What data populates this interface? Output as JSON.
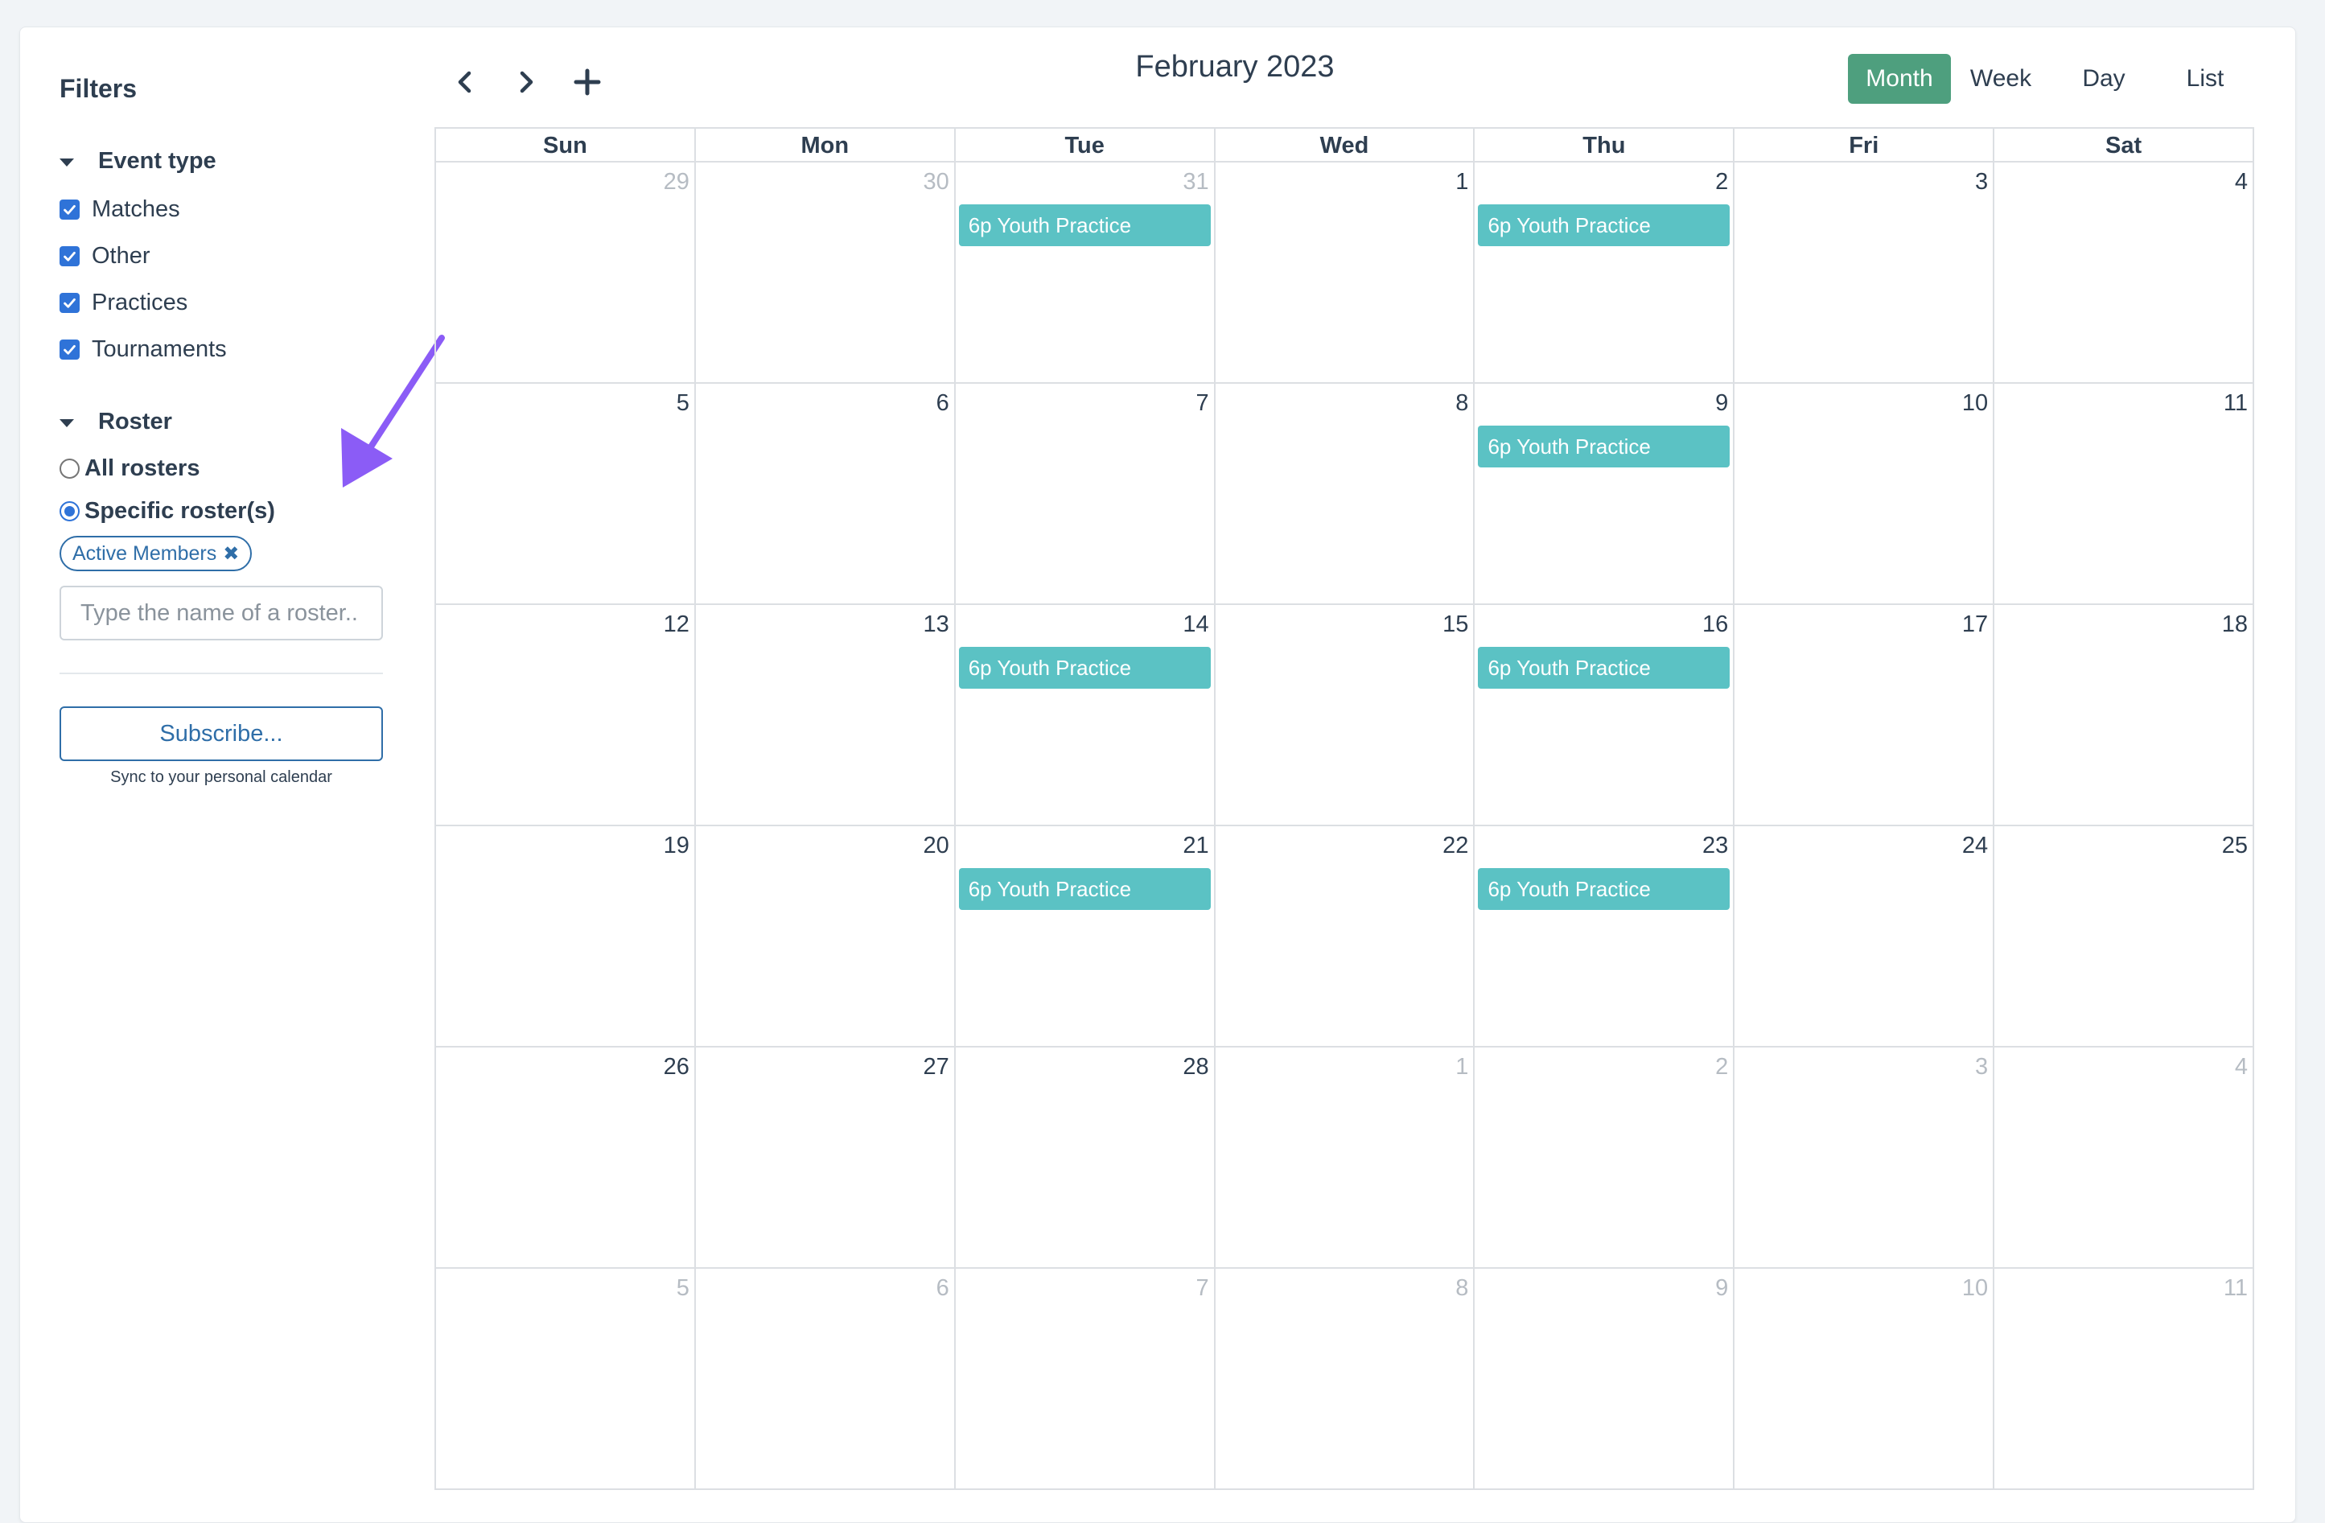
{
  "sidebar": {
    "filters_title": "Filters",
    "event_type": {
      "label": "Event type",
      "options": [
        {
          "label": "Matches",
          "checked": true
        },
        {
          "label": "Other",
          "checked": true
        },
        {
          "label": "Practices",
          "checked": true
        },
        {
          "label": "Tournaments",
          "checked": true
        }
      ]
    },
    "roster": {
      "label": "Roster",
      "all_label": "All rosters",
      "specific_label": "Specific roster(s)",
      "selected": "specific",
      "tag": "Active Members",
      "input_placeholder": "Type the name of a roster..",
      "input_value": ""
    },
    "subscribe_label": "Subscribe...",
    "sync_note": "Sync to your personal calendar"
  },
  "toolbar": {
    "title": "February 2023",
    "prev_icon": "chevron-left-icon",
    "next_icon": "chevron-right-icon",
    "add_icon": "plus-icon",
    "views": [
      "Month",
      "Week",
      "Day",
      "List"
    ],
    "active_view": "Month"
  },
  "calendar": {
    "weekdays": [
      "Sun",
      "Mon",
      "Tue",
      "Wed",
      "Thu",
      "Fri",
      "Sat"
    ],
    "weeks": [
      [
        {
          "n": "29",
          "o": true
        },
        {
          "n": "30",
          "o": true
        },
        {
          "n": "31",
          "o": true,
          "ev": "6p Youth Practice"
        },
        {
          "n": "1"
        },
        {
          "n": "2",
          "ev": "6p Youth Practice"
        },
        {
          "n": "3"
        },
        {
          "n": "4"
        }
      ],
      [
        {
          "n": "5"
        },
        {
          "n": "6"
        },
        {
          "n": "7"
        },
        {
          "n": "8"
        },
        {
          "n": "9",
          "ev": "6p Youth Practice"
        },
        {
          "n": "10"
        },
        {
          "n": "11"
        }
      ],
      [
        {
          "n": "12"
        },
        {
          "n": "13"
        },
        {
          "n": "14",
          "ev": "6p Youth Practice"
        },
        {
          "n": "15"
        },
        {
          "n": "16",
          "ev": "6p Youth Practice"
        },
        {
          "n": "17"
        },
        {
          "n": "18"
        }
      ],
      [
        {
          "n": "19"
        },
        {
          "n": "20"
        },
        {
          "n": "21",
          "ev": "6p Youth Practice"
        },
        {
          "n": "22"
        },
        {
          "n": "23",
          "ev": "6p Youth Practice"
        },
        {
          "n": "24"
        },
        {
          "n": "25"
        }
      ],
      [
        {
          "n": "26"
        },
        {
          "n": "27"
        },
        {
          "n": "28"
        },
        {
          "n": "1",
          "o": true
        },
        {
          "n": "2",
          "o": true
        },
        {
          "n": "3",
          "o": true
        },
        {
          "n": "4",
          "o": true
        }
      ],
      [
        {
          "n": "5",
          "o": true
        },
        {
          "n": "6",
          "o": true
        },
        {
          "n": "7",
          "o": true
        },
        {
          "n": "8",
          "o": true
        },
        {
          "n": "9",
          "o": true
        },
        {
          "n": "10",
          "o": true
        },
        {
          "n": "11",
          "o": true
        }
      ]
    ]
  },
  "colors": {
    "accent_blue": "#2f73d8",
    "active_view_bg": "#4e9f7e",
    "event_bg": "#5bc2c4",
    "annotation_arrow": "#8b5cf6"
  }
}
